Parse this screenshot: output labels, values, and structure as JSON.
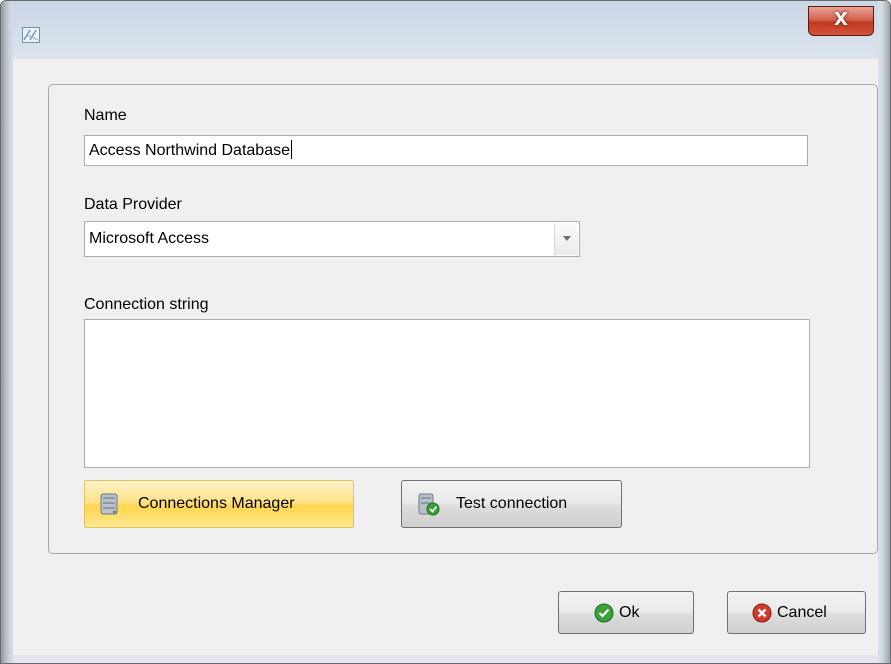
{
  "window": {
    "icon": "connection-icon",
    "close_glyph": "X"
  },
  "form": {
    "name_label": "Name",
    "name_value": "Access Northwind Database",
    "provider_label": "Data Provider",
    "provider_value": "Microsoft Access",
    "connection_label": "Connection string",
    "connection_value": ""
  },
  "buttons": {
    "connections_manager": "Connections Manager",
    "test_connection": "Test connection",
    "ok": "Ok",
    "cancel": "Cancel"
  },
  "colors": {
    "highlight_button": "#ffd64f",
    "ok_icon": "#3aa13a",
    "cancel_icon": "#d23a2a",
    "close_button": "#c0391f"
  }
}
